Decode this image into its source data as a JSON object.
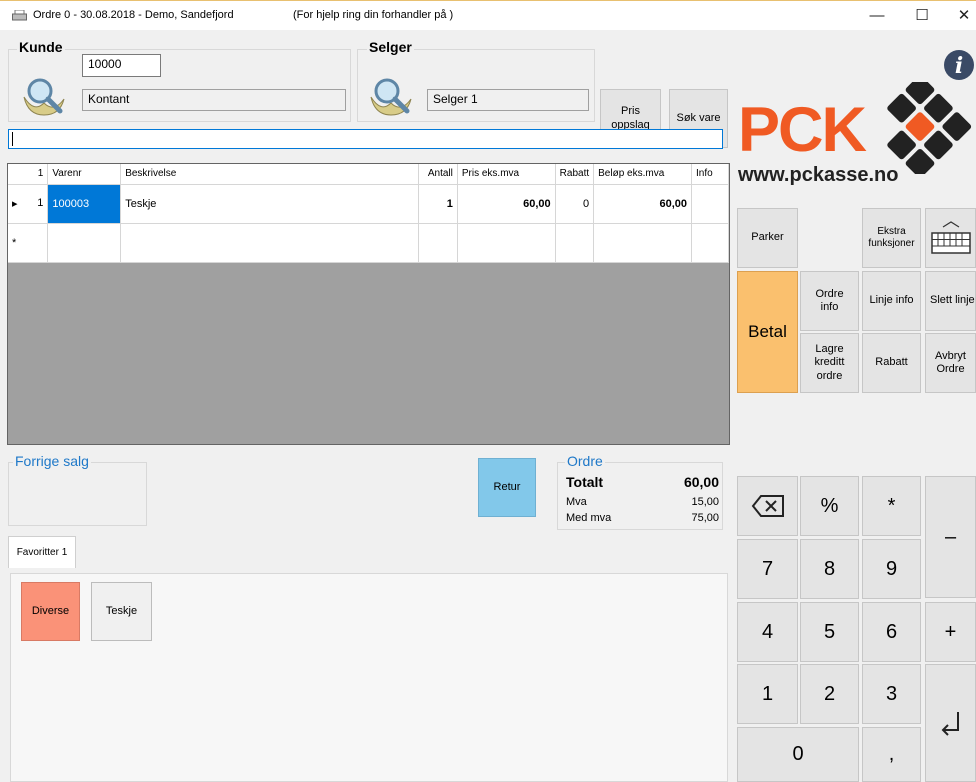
{
  "window": {
    "title": "Ordre 0 - 30.08.2018 - Demo, Sandefjord",
    "help": "(For hjelp ring din forhandler  på )",
    "minimize": "—",
    "maximize": "☐",
    "close": "✕"
  },
  "customer": {
    "heading": "Kunde",
    "number": "10000",
    "name": "Kontant"
  },
  "seller": {
    "heading": "Selger",
    "name": "Selger 1"
  },
  "search_buttons": {
    "price_lookup": "Pris oppslag",
    "find_item": "Søk vare"
  },
  "search": {
    "value": ""
  },
  "grid": {
    "columns": [
      "",
      "Varenr",
      "Beskrivelse",
      "Antall",
      "Pris eks.mva",
      "Rabatt",
      "Beløp eks.mva",
      "Info"
    ],
    "header_index": "1",
    "rows": [
      {
        "indicator": "▸",
        "index": "1",
        "item_no": "100003",
        "description": "Teskje",
        "quantity": "1",
        "price": "60,00",
        "discount": "0",
        "amount": "60,00",
        "info": ""
      }
    ],
    "new_row_marker": "*"
  },
  "previous_sale": {
    "label": "Forrige salg"
  },
  "return_button": "Retur",
  "order_summary": {
    "label": "Ordre",
    "total_label": "Totalt",
    "total_value": "60,00",
    "vat_label": "Mva",
    "vat_value": "15,00",
    "incl_vat_label": "Med mva",
    "incl_vat_value": "75,00"
  },
  "favorites": {
    "tab": "Favoritter 1",
    "items": [
      {
        "label": "Diverse",
        "color": "#fa9278"
      },
      {
        "label": "Teskje",
        "color": "#f0f0f0"
      }
    ]
  },
  "logo": {
    "brand": "PCK",
    "url": "www.pckasse.no",
    "brand_color": "#f05a23",
    "info_icon": "i"
  },
  "actions": {
    "park": "Parker",
    "extra_functions": "Ekstra funksjoner",
    "pay": "Betal",
    "pay_color": "#fac06e",
    "order_info": "Ordre info",
    "line_info": "Linje info",
    "delete_line": "Slett linje",
    "save_credit_order": "Lagre kreditt ordre",
    "discount": "Rabatt",
    "cancel_order": "Avbryt Ordre"
  },
  "keypad": {
    "percent": "%",
    "multiply": "*",
    "minus": "–",
    "plus": "+",
    "k7": "7",
    "k8": "8",
    "k9": "9",
    "k4": "4",
    "k5": "5",
    "k6": "6",
    "k1": "1",
    "k2": "2",
    "k3": "3",
    "k0": "0",
    "comma": ","
  }
}
